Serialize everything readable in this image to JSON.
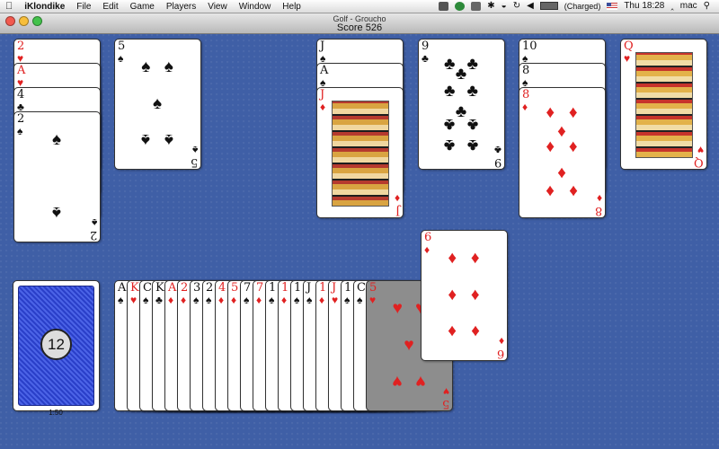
{
  "menubar": {
    "app_name": "iKlondike",
    "menus": [
      "File",
      "Edit",
      "Game",
      "Players",
      "View",
      "Window",
      "Help"
    ],
    "battery_text": "(Charged)",
    "clock": "Thu 18:28",
    "user": "mac"
  },
  "window": {
    "title": "Golf - Groucho",
    "score": "Score 526"
  },
  "stock": {
    "count": "12",
    "timer": "1:50"
  },
  "tableau": [
    {
      "cards": [
        {
          "rank": "2",
          "suit": "♥"
        },
        {
          "rank": "A",
          "suit": "♥"
        },
        {
          "rank": "4",
          "suit": "♣"
        },
        {
          "rank": "2",
          "suit": "♠"
        }
      ]
    },
    {
      "cards": [
        {
          "rank": "5",
          "suit": "♠"
        }
      ]
    },
    {
      "cards": [
        {
          "rank": "J",
          "suit": "♠"
        },
        {
          "rank": "A",
          "suit": "♠"
        },
        {
          "rank": "J",
          "suit": "♦"
        }
      ]
    },
    {
      "cards": [
        {
          "rank": "9",
          "suit": "♣"
        }
      ]
    },
    {
      "cards": [
        {
          "rank": "10",
          "suit": "♠"
        },
        {
          "rank": "8",
          "suit": "♠"
        },
        {
          "rank": "8",
          "suit": "♦"
        }
      ]
    },
    {
      "cards": [
        {
          "rank": "Q",
          "suit": "♥"
        }
      ]
    }
  ],
  "waste": {
    "fanned": [
      {
        "rank": "A",
        "suit": "♠"
      },
      {
        "rank": "K",
        "suit": "♥"
      },
      {
        "rank": "C",
        "suit": "♠"
      },
      {
        "rank": "K",
        "suit": "♣"
      },
      {
        "rank": "A",
        "suit": "♦"
      },
      {
        "rank": "2",
        "suit": "♦"
      },
      {
        "rank": "3",
        "suit": "♠"
      },
      {
        "rank": "2",
        "suit": "♠"
      },
      {
        "rank": "4",
        "suit": "♦"
      },
      {
        "rank": "5",
        "suit": "♦"
      },
      {
        "rank": "7",
        "suit": "♠"
      },
      {
        "rank": "7",
        "suit": "♦"
      },
      {
        "rank": "1",
        "suit": "♠"
      },
      {
        "rank": "1",
        "suit": "♦"
      },
      {
        "rank": "1",
        "suit": "♠"
      },
      {
        "rank": "J",
        "suit": "♠"
      },
      {
        "rank": "1",
        "suit": "♦"
      },
      {
        "rank": "J",
        "suit": "♥"
      },
      {
        "rank": "1",
        "suit": "♠"
      },
      {
        "rank": "C",
        "suit": "♠"
      }
    ],
    "top": {
      "rank": "5",
      "suit": "♥"
    }
  },
  "dragged": {
    "rank": "6",
    "suit": "♦"
  },
  "colors": {
    "felt": "#3f5fa6",
    "red": "#e02121",
    "black": "#111111",
    "card_back": "#2a3fc9"
  }
}
